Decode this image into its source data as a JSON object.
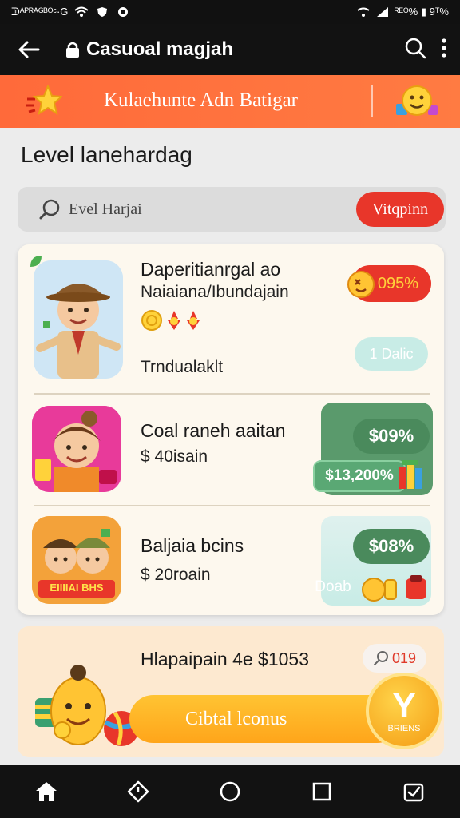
{
  "status_bar": {
    "left_text": "ᗫᴬᴾᴿᴬᴳᴮᴼᶜ·G",
    "right_text": "ᴿᴱᴼ% ▮ 9ᵀ%"
  },
  "app_bar": {
    "title": "Casuoal magjah"
  },
  "promo_banner": {
    "text": "Kulaehunte Adn Batigar"
  },
  "section_title": "Level lanehardag",
  "search": {
    "placeholder": "Evel Harjai",
    "button_label": "Vitqpinn"
  },
  "games": [
    {
      "name": "Daperitianrgal ao",
      "subtitle": "Naiaiana/Ibundajain",
      "caption": "Trndualaklt",
      "discount_badge": "095%",
      "tag": "1 Dalic"
    },
    {
      "name": "Coal raneh aaitan",
      "price": "$ 40isain",
      "price_badge": "$09%",
      "value_badge": "$13,200%"
    },
    {
      "name": "Baljaia bcins",
      "price": "$ 20roain",
      "thumb_label": "EIIIIAI BHS",
      "price_badge": "$08%",
      "tag": "Doab"
    }
  ],
  "bonus": {
    "title": "Hlapaipain 4e $1053",
    "chip_value": "019",
    "cta_label": "Cibtal lconus",
    "coin_label": "BRIENS"
  },
  "colors": {
    "promo": "#ff6a3a",
    "accent_red": "#e8362a",
    "green_badge": "#5a9a6c",
    "gold": "#ffb020"
  }
}
